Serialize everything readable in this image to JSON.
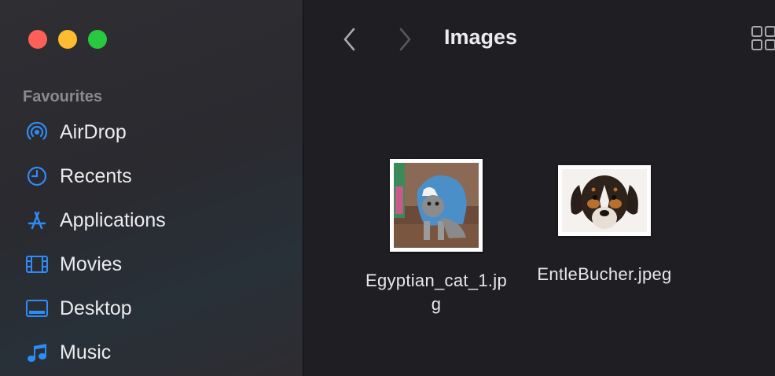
{
  "window": {
    "traffic_lights": {
      "close": "#fe5f57",
      "minimize": "#febc2e",
      "maximize": "#28c840"
    }
  },
  "sidebar": {
    "section_title": "Favourites",
    "accent_color": "#2f8cf6",
    "items": [
      {
        "label": "AirDrop",
        "icon": "airdrop-icon"
      },
      {
        "label": "Recents",
        "icon": "clock-icon"
      },
      {
        "label": "Applications",
        "icon": "applications-icon"
      },
      {
        "label": "Movies",
        "icon": "film-icon"
      },
      {
        "label": "Desktop",
        "icon": "desktop-icon"
      },
      {
        "label": "Music",
        "icon": "music-note-icon"
      }
    ]
  },
  "toolbar": {
    "title": "Images",
    "back_icon": "chevron-left-icon",
    "forward_icon": "chevron-right-icon",
    "view_icon": "grid-view-icon"
  },
  "files": [
    {
      "name": "Egyptian_cat_1.jpg",
      "name_line1": "Egyptian_cat_1.jp",
      "name_line2": "g",
      "thumbnail": "cat-in-shark-costume-photo"
    },
    {
      "name": "EntleBucher.jpeg",
      "thumbnail": "puppy-photo"
    }
  ]
}
